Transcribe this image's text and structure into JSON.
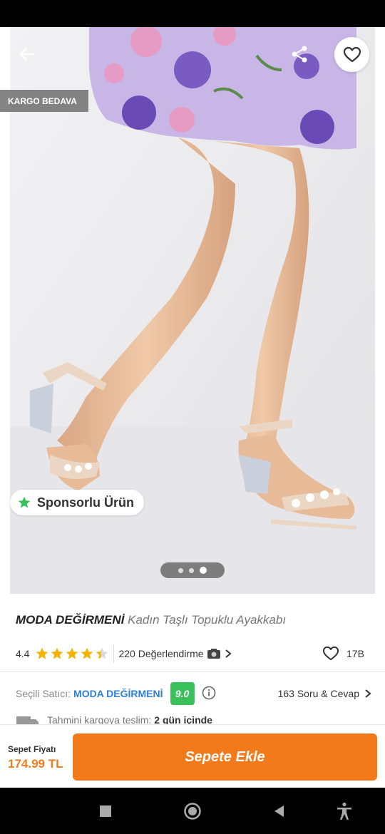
{
  "colors": {
    "accent": "#f27a1a",
    "seller_link": "#2d7fd1",
    "score_badge": "#3ac15c",
    "star": "#f5b301"
  },
  "hero": {
    "kargo_badge": "KARGO BEDAVA",
    "sponsor_badge": "Sponsorlu Ürün",
    "image_count": 3,
    "active_image": 3,
    "icons": {
      "back": "arrow-left-icon",
      "share": "share-icon",
      "favorite": "heart-outline-icon"
    }
  },
  "product": {
    "brand": "MODA DEĞİRMENİ",
    "name": "Kadın Taşlı Topuklu Ayakkabı",
    "rating": "4.4",
    "rating_value": 4.4,
    "reviews": "220 Değerlendirme",
    "favorites": "17B"
  },
  "seller": {
    "label": "Seçili Satıcı:",
    "name": "MODA DEĞİRMENİ",
    "score": "9.0",
    "qa": "163 Soru & Cevap"
  },
  "delivery": {
    "label": "Tahmini kargoya teslim:",
    "value": "2 gün içinde"
  },
  "bottom_bar": {
    "price_label": "Sepet Fiyatı",
    "price": "174.99 TL",
    "cart_button": "Sepete Ekle"
  }
}
